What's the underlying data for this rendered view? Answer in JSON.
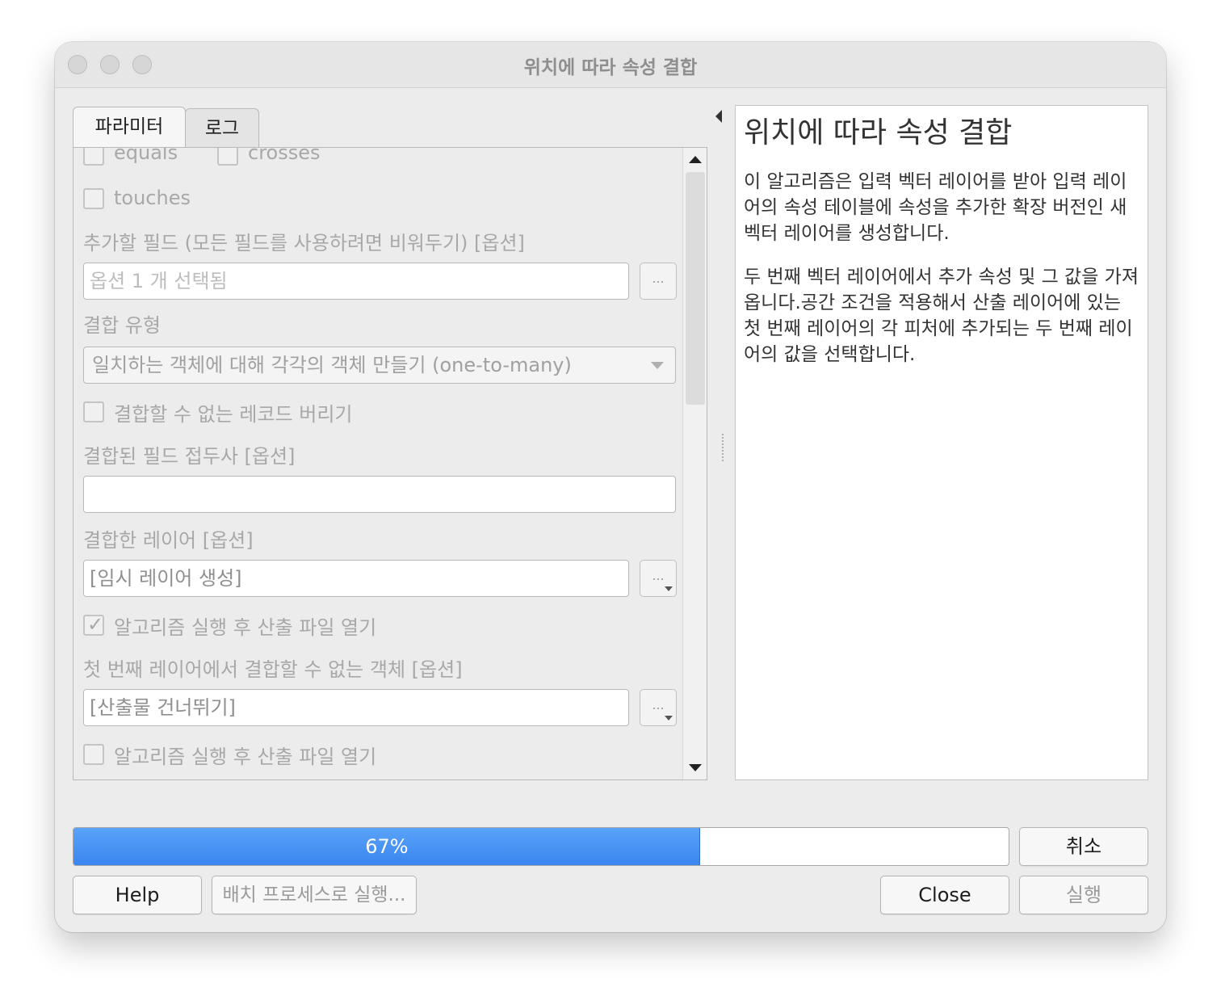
{
  "window": {
    "title": "위치에 따라 속성 결합"
  },
  "tabs": [
    {
      "label": "파라미터",
      "active": true
    },
    {
      "label": "로그",
      "active": false
    }
  ],
  "params": {
    "top_checkboxes": [
      "equals",
      "crosses"
    ],
    "touches_label": "touches",
    "fields_label": "추가할 필드 (모든 필드를 사용하려면 비워두기) [옵션]",
    "fields_placeholder": "옵션 1 개 선택됨",
    "browse_button": "...",
    "join_type_label": "결합 유형",
    "join_type_value": "일치하는 객체에 대해 각각의 객체 만들기 (one-to-many)",
    "discard_label": "결합할 수 없는 레코드 버리기",
    "prefix_label": "결합된 필드 접두사 [옵션]",
    "prefix_value": "",
    "joined_layer_label": "결합한 레이어 [옵션]",
    "joined_layer_value": "[임시 레이어 생성]",
    "open_output_1_label": "알고리즘 실행 후 산출 파일 열기",
    "open_output_1_checked": true,
    "unjoinable_label": "첫 번째 레이어에서 결합할 수 없는 객체 [옵션]",
    "unjoinable_value": "[산출물 건너뛰기]",
    "open_output_2_label": "알고리즘 실행 후 산출 파일 열기",
    "open_output_2_checked": false
  },
  "help": {
    "title": "위치에 따라 속성 결합",
    "paragraphs": [
      "이 알고리즘은 입력 벡터 레이어를 받아 입력 레이어의 속성 테이블에 속성을 추가한 확장 버전인 새 벡터 레이어를 생성합니다.",
      "두 번째 벡터 레이어에서 추가 속성 및 그 값을 가져옵니다.공간 조건을 적용해서 산출 레이어에 있는 첫 번째 레이어의 각 피처에 추가되는 두 번째 레이어의 값을 선택합니다."
    ]
  },
  "progress": {
    "value": 0.67,
    "label": "67%"
  },
  "buttons": {
    "cancel": "취소",
    "help": "Help",
    "batch": "배치 프로세스로 실행...",
    "close": "Close",
    "run": "실행"
  },
  "colors": {
    "progress_fill": "#3a86f0",
    "disabled_text": "#a8a8a8"
  }
}
